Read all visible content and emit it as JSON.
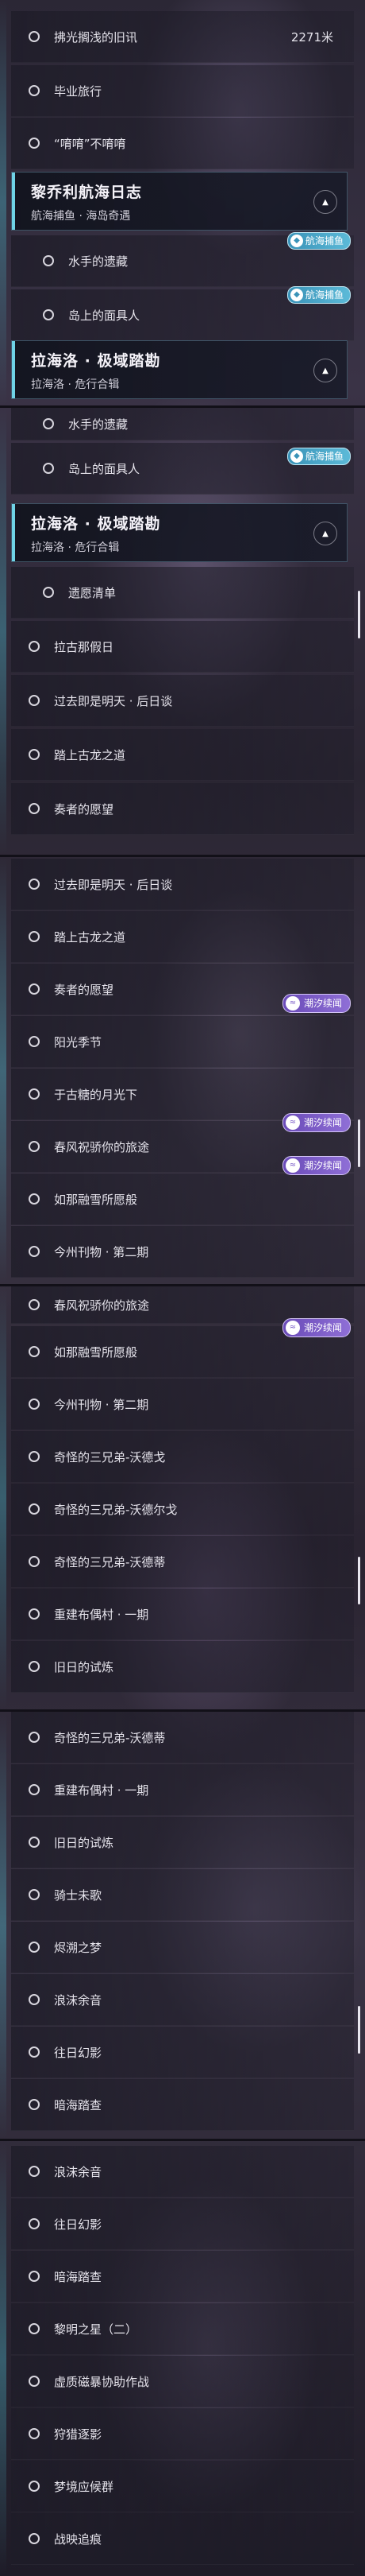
{
  "shot1": {
    "top_rows": [
      {
        "label": "拂光搁浅的旧讯",
        "distance": "2271米"
      },
      {
        "label": "毕业旅行"
      },
      {
        "label": "“唷唷”不唷唷"
      }
    ],
    "header1": {
      "title": "黎乔利航海日志",
      "subtitle": "航海捕鱼 · 海岛奇遇"
    },
    "sub_rows": [
      {
        "label": "水手的遗藏",
        "badge": "航海捕鱼"
      },
      {
        "label": "岛上的面具人",
        "badge": "航海捕鱼"
      }
    ],
    "header2": {
      "title": "拉海洛 · 极域踏勘",
      "subtitle": "拉海洛 · 危行合辑"
    }
  },
  "shot2": {
    "sub_rows": [
      {
        "label": "水手的遗藏"
      },
      {
        "label": "岛上的面具人",
        "badge": "航海捕鱼"
      }
    ],
    "header": {
      "title": "拉海洛 · 极域踏勘",
      "subtitle": "拉海洛 · 危行合辑"
    },
    "rows": [
      "遗愿清单",
      "拉古那假日",
      "过去即是明天 · 后日谈",
      "踏上古龙之道",
      "奏者的愿望"
    ]
  },
  "shot3": {
    "rows": [
      {
        "label": "过去即是明天 · 后日谈"
      },
      {
        "label": "踏上古龙之道"
      },
      {
        "label": "奏者的愿望"
      },
      {
        "label": "阳光季节",
        "badge": "潮汐续闻"
      },
      {
        "label": "于古糖的月光下"
      },
      {
        "label": "春风祝骄你的旅途",
        "badge": "潮汐续闻"
      },
      {
        "label": "如那融雪所愿般",
        "badge": "潮汐续闻"
      },
      {
        "label": "今州刊物 · 第二期"
      }
    ]
  },
  "shot4": {
    "rows": [
      {
        "label": "春风祝骄你的旅途"
      },
      {
        "label": "如那融雪所愿般",
        "badge": "潮汐续闻"
      },
      {
        "label": "今州刊物 · 第二期"
      },
      {
        "label": "奇怪的三兄弟-沃德戈"
      },
      {
        "label": "奇怪的三兄弟-沃德尔戈"
      },
      {
        "label": "奇怪的三兄弟-沃德蒂"
      },
      {
        "label": "重建布偶村 · 一期"
      },
      {
        "label": "旧日的试炼"
      }
    ]
  },
  "shot5": {
    "rows": [
      "奇怪的三兄弟-沃德蒂",
      "重建布偶村 · 一期",
      "旧日的试炼",
      "骑士未歌",
      "烬溯之梦",
      "浪沫余音",
      "往日幻影",
      "暗海踏查"
    ]
  },
  "shot6": {
    "rows": [
      "浪沫余音",
      "往日幻影",
      "暗海踏查",
      "黎明之星（二）",
      "虚质磁暴协助作战",
      "狩猎逐影",
      "梦境应候群",
      "战映追痕"
    ]
  },
  "colors": {
    "accent_cyan": "#6fd3e6",
    "badge_blue": "#3a93b8",
    "badge_purple": "#7a5bc8"
  },
  "icons": {
    "toggle": "chevron-up-icon",
    "row": "ring-icon",
    "badge_blue": "fish-icon",
    "badge_purple": "wave-icon"
  }
}
